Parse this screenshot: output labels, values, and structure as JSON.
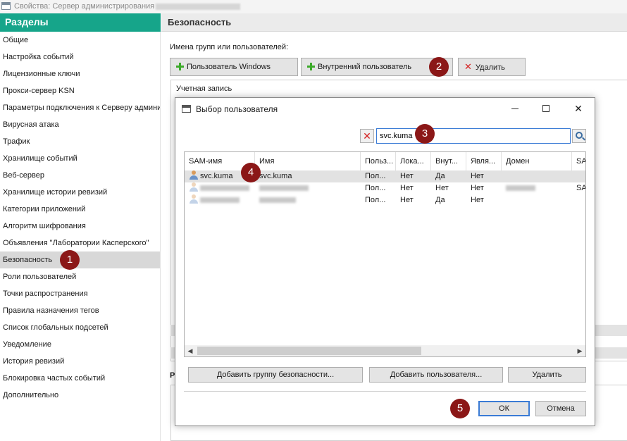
{
  "window": {
    "title": "Свойства: Сервер администрирования"
  },
  "sidebar": {
    "header": "Разделы",
    "items": [
      "Общие",
      "Настройка событий",
      "Лицензионные ключи",
      "Прокси-сервер KSN",
      "Параметры подключения к Серверу админи",
      "Вирусная атака",
      "Трафик",
      "Хранилище событий",
      "Веб-сервер",
      "Хранилище истории ревизий",
      "Категории приложений",
      "Алгоритм шифрования",
      "Объявления \"Лаборатории Касперского\"",
      "Безопасность",
      "Роли пользователей",
      "Точки распространения",
      "Правила назначения тегов",
      "Список глобальных подсетей",
      "Уведомление",
      "История ревизий",
      "Блокировка частых событий",
      "Дополнительно"
    ],
    "active_index": 13
  },
  "main": {
    "title": "Безопасность",
    "groups_label": "Имена групп или пользователей:",
    "btn_windows_user": "Пользователь Windows",
    "btn_internal_user": "Внутренний пользователь",
    "btn_delete": "Удалить",
    "account_label": "Учетная запись",
    "second_section_letter": "Р"
  },
  "dialog": {
    "title": "Выбор пользователя",
    "search_value": "svc.kuma",
    "columns": [
      "SAM-имя",
      "Имя",
      "Польз...",
      "Лока...",
      "Внут...",
      "Явля...",
      "Домен",
      "SA"
    ],
    "rows": [
      {
        "sam": "svc.kuma",
        "name": "svc.kuma",
        "c3": "Пол...",
        "c4": "Нет",
        "c5": "Да",
        "c6": "Нет",
        "domain": "",
        "c8": ""
      },
      {
        "sam": "",
        "name": "",
        "c3": "Пол...",
        "c4": "Нет",
        "c5": "Нет",
        "c6": "Нет",
        "domain": "",
        "c8": "SA"
      },
      {
        "sam": "",
        "name": "",
        "c3": "Пол...",
        "c4": "Нет",
        "c5": "Да",
        "c6": "Нет",
        "domain": "",
        "c8": ""
      }
    ],
    "btn_add_group": "Добавить группу безопасности...",
    "btn_add_user": "Добавить пользователя...",
    "btn_remove": "Удалить",
    "btn_ok": "ОК",
    "btn_cancel": "Отмена"
  },
  "markers": [
    "1",
    "2",
    "3",
    "4",
    "5"
  ]
}
